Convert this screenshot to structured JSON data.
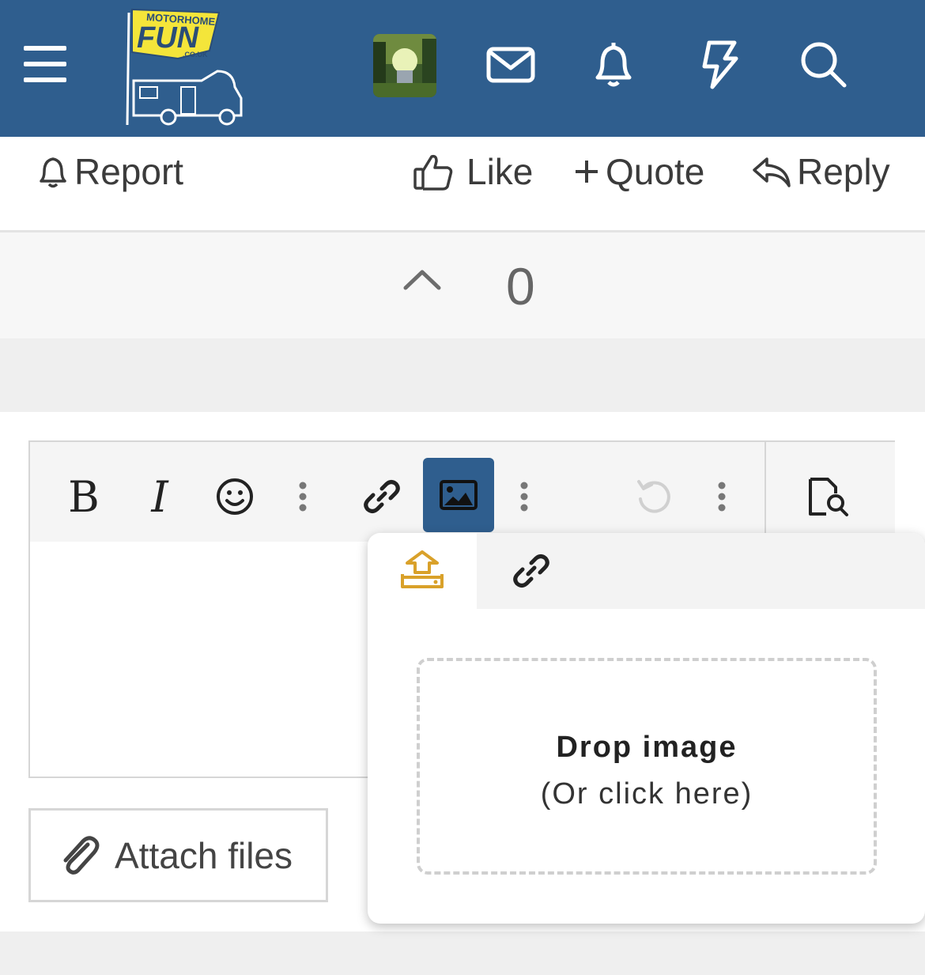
{
  "header": {
    "logo": {
      "top": "MOTORHOME",
      "main": "FUN",
      "sub": ".CO.UK"
    },
    "icons": [
      "menu-icon",
      "envelope-icon",
      "bell-icon",
      "lightning-icon",
      "search-icon"
    ],
    "colors": {
      "background": "#2f5e8e",
      "logo_yellow": "#f4e53a"
    }
  },
  "post_actions": {
    "report": "Report",
    "like": "Like",
    "quote": "Quote",
    "reply": "Reply"
  },
  "vote": {
    "count": "0"
  },
  "editor": {
    "toolbar": {
      "bold": "B",
      "italic": "I",
      "active_color": "#2f5e8e"
    },
    "attach_label": "Attach files"
  },
  "image_popup": {
    "tabs": [
      "upload-icon",
      "link-icon"
    ],
    "upload_color": "#d9a12a",
    "drop_title": "Drop image",
    "drop_subtitle": "(Or click here)"
  }
}
